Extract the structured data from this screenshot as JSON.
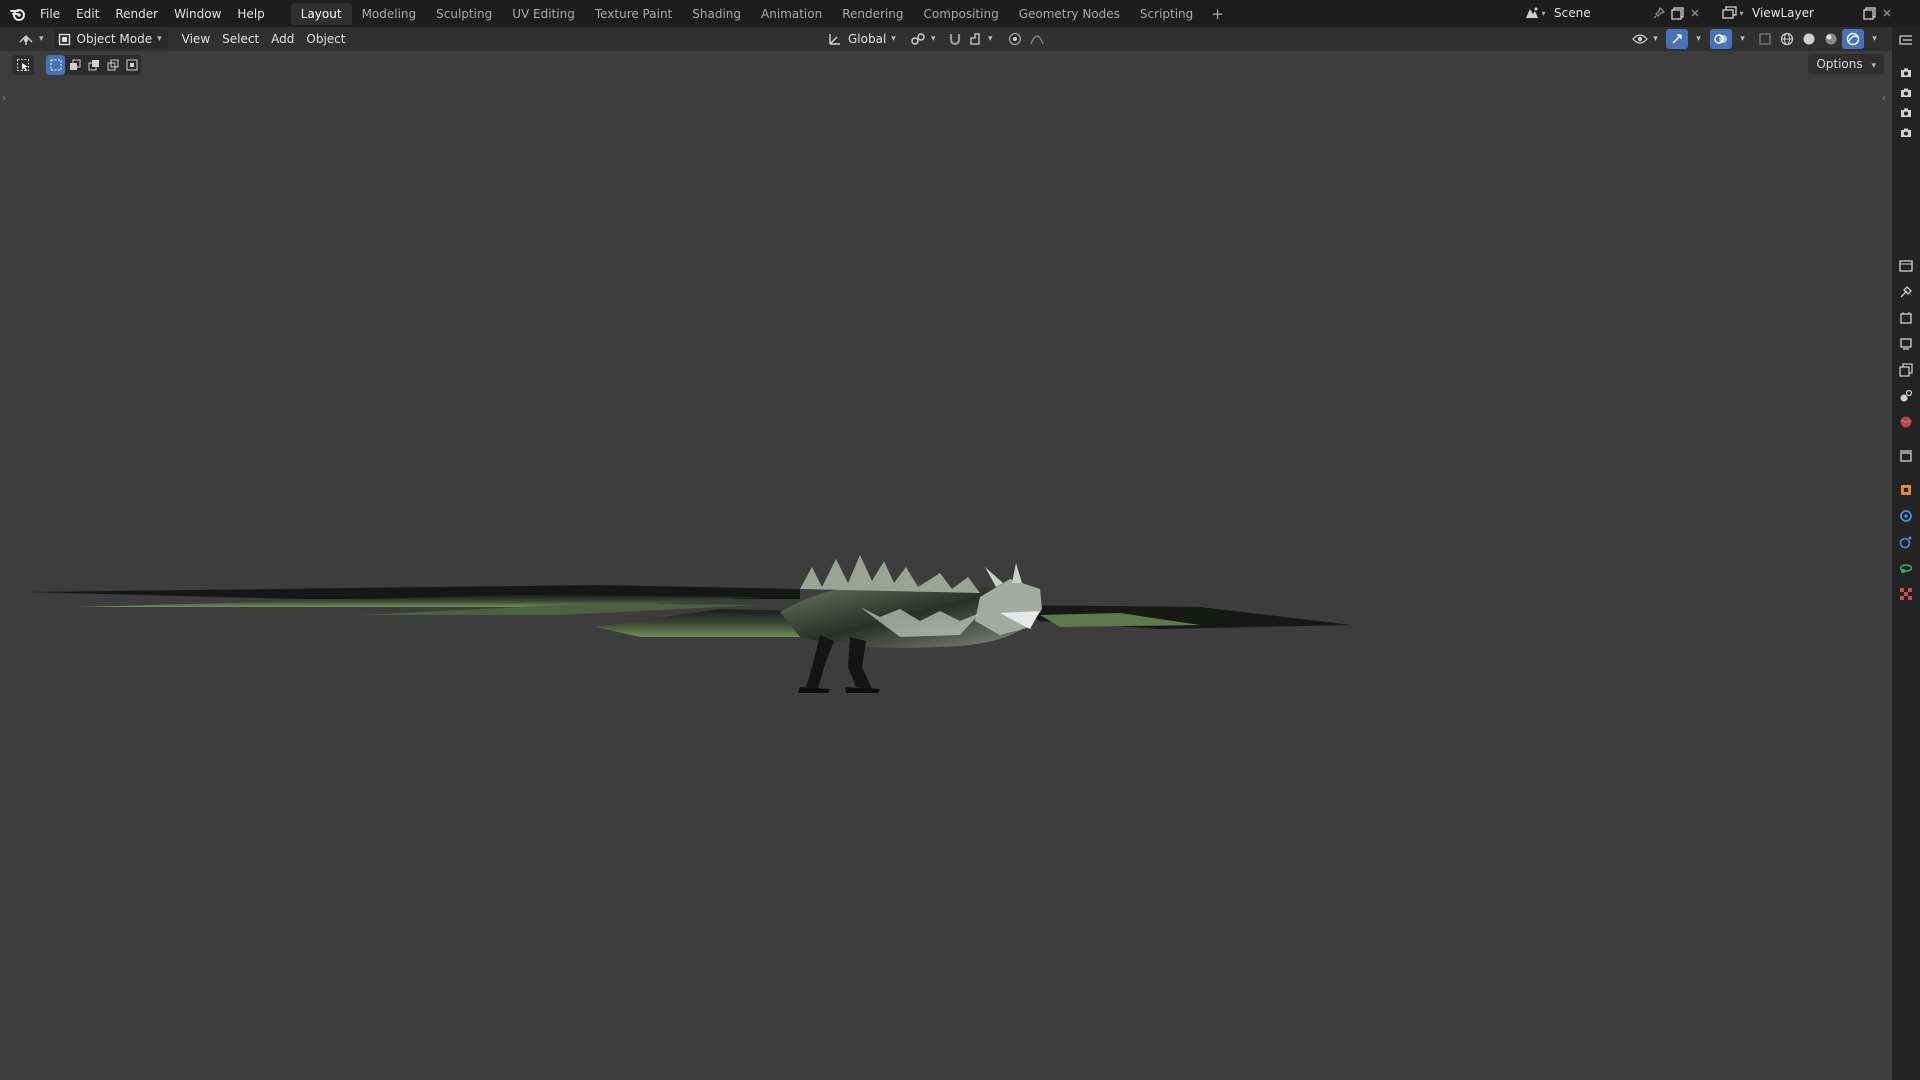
{
  "topbar": {
    "menus": [
      "File",
      "Edit",
      "Render",
      "Window",
      "Help"
    ],
    "workspaces": [
      "Layout",
      "Modeling",
      "Sculpting",
      "UV Editing",
      "Texture Paint",
      "Shading",
      "Animation",
      "Rendering",
      "Compositing",
      "Geometry Nodes",
      "Scripting"
    ],
    "active_workspace": "Layout",
    "add_workspace": "+",
    "scene_name": "Scene",
    "view_layer_name": "ViewLayer"
  },
  "header": {
    "mode": "Object Mode",
    "menus": [
      "View",
      "Select",
      "Add",
      "Object"
    ],
    "transform_orientation": "Global"
  },
  "tool_header": {
    "options_label": "Options"
  },
  "colors": {
    "accent": "#4772b3",
    "topbar_bg": "#1d1d1d",
    "header_bg": "#303030",
    "viewport_bg": "#3d3d3d",
    "dragon_green": "#6f8f5a"
  },
  "icons": {
    "logo": "blender-logo-icon",
    "editor_type": "3d-viewport-icon",
    "scene": "scene-icon",
    "view_layer": "render-layers-icon",
    "properties_tabs": [
      "tool-icon",
      "render-icon",
      "output-icon",
      "view-layer-icon",
      "scene-icon",
      "world-icon",
      "collection-icon",
      "object-icon",
      "modifier-icon",
      "particles-icon",
      "physics-icon",
      "constraints-icon",
      "texture-icon"
    ]
  }
}
